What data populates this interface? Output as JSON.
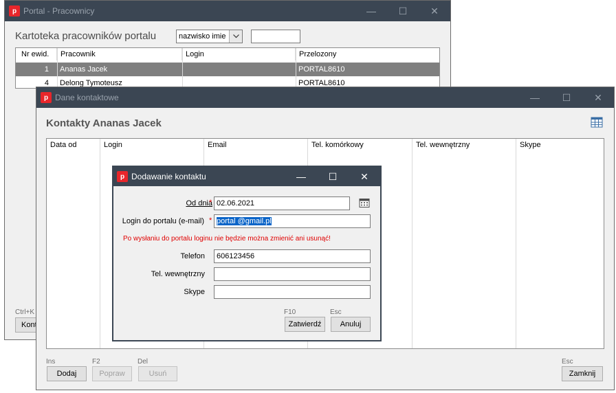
{
  "main_window": {
    "title": "Portal - Pracownicy",
    "heading": "Kartoteka pracowników portalu",
    "sort_select": "nazwisko imie",
    "search_value": "",
    "columns": [
      "Nr ewid.",
      "Pracownik",
      "Login",
      "Przelozony"
    ],
    "rows": [
      {
        "nr": "1",
        "name": "Ananas Jacek",
        "login": "",
        "supervisor": "PORTAL8610"
      },
      {
        "nr": "4",
        "name": "Delong Tymoteusz",
        "login": "",
        "supervisor": "PORTAL8610"
      }
    ],
    "hint_ctrl": "Ctrl+K",
    "btn_kont": "Kont"
  },
  "contacts_window": {
    "title": "Dane kontaktowe",
    "heading": "Kontakty Ananas Jacek",
    "columns": [
      "Data od",
      "Login",
      "Email",
      "Tel. komórkowy",
      "Tel. wewnętrzny",
      "Skype"
    ],
    "buttons": {
      "add_hint": "Ins",
      "add": "Dodaj",
      "edit_hint": "F2",
      "edit": "Popraw",
      "delete_hint": "Del",
      "delete": "Usuń",
      "close_hint": "Esc",
      "close": "Zamknij"
    }
  },
  "dialog": {
    "title": "Dodawanie kontaktu",
    "fields": {
      "date_label": "Od dnia",
      "date_value": "02.06.2021",
      "login_label": "Login do portalu (e-mail)",
      "login_value": "portal @gmail.pl",
      "warning": "Po wysłaniu do portalu loginu nie będzie można zmienić ani usunąć!",
      "phone_label": "Telefon",
      "phone_value": "606123456",
      "ext_label": "Tel. wewnętrzny",
      "ext_value": "",
      "skype_label": "Skype",
      "skype_value": ""
    },
    "required_mark": "*",
    "confirm_hint": "F10",
    "confirm": "Zatwierdź",
    "cancel_hint": "Esc",
    "cancel": "Anuluj"
  },
  "window_controls": {
    "minimize": "—",
    "maximize": "☐",
    "close": "✕"
  },
  "colors": {
    "titlebar": "#3b4653",
    "selected_row": "#7f7f7f",
    "warning": "#e00000",
    "app_icon": "#e8262b"
  }
}
